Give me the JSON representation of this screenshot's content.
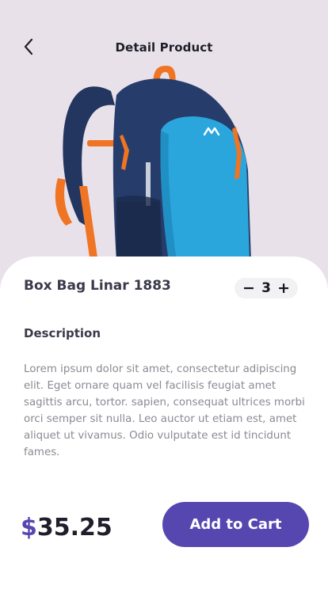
{
  "header": {
    "title": "Detail Product",
    "back_icon": "chevron-left-icon"
  },
  "product": {
    "name": "Box Bag Linar 1883",
    "image_icon": "backpack-image"
  },
  "quantity": {
    "decrement_label": "−",
    "value": "3",
    "increment_label": "+"
  },
  "description": {
    "title": "Description",
    "text": "Lorem ipsum dolor sit amet, consectetur adipiscing elit. Eget ornare quam vel facilisis feugiat amet sagittis arcu, tortor. sapien, consequat ultrices morbi orci semper sit nulla. Leo auctor ut etiam est, amet aliquet ut vivamus. Odio vulputate est id tincidunt fames."
  },
  "footer": {
    "currency": "$",
    "price": "35.25",
    "add_to_cart_label": "Add to Cart"
  },
  "colors": {
    "background": "#e9e1e9",
    "accent": "#5646b0",
    "bag_navy": "#263c6b",
    "bag_blue": "#2aa6dc",
    "bag_orange": "#f07a2a"
  }
}
